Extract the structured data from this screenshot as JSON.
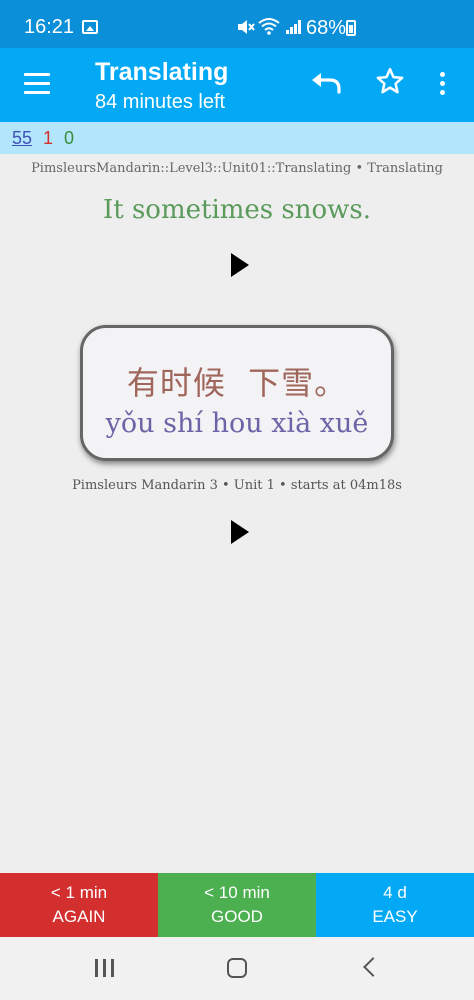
{
  "status_bar": {
    "time": "16:21",
    "battery": "68%"
  },
  "app_bar": {
    "title": "Translating",
    "subtitle": "84 minutes left"
  },
  "counts": {
    "new": "55",
    "learning": "1",
    "review": "0"
  },
  "card": {
    "deck_path": "PimsleursMandarin::Level3::Unit01::Translating • Translating",
    "prompt": "It sometimes snows.",
    "hanzi": "有时候  下雪。",
    "pinyin": "yǒu shí hou xià xuě",
    "source": "Pimsleurs Mandarin 3 • Unit 1 • starts at 04m18s"
  },
  "answer_buttons": [
    {
      "time": "< 1 min",
      "label": "AGAIN",
      "color": "#d32f2f"
    },
    {
      "time": "< 10 min",
      "label": "GOOD",
      "color": "#4caf50"
    },
    {
      "time": "4 d",
      "label": "EASY",
      "color": "#03a9f4"
    }
  ],
  "colors": {
    "status_bar": "#0a8fd8",
    "app_bar": "#03a9f4",
    "counts_bar": "#b3e5fc"
  }
}
